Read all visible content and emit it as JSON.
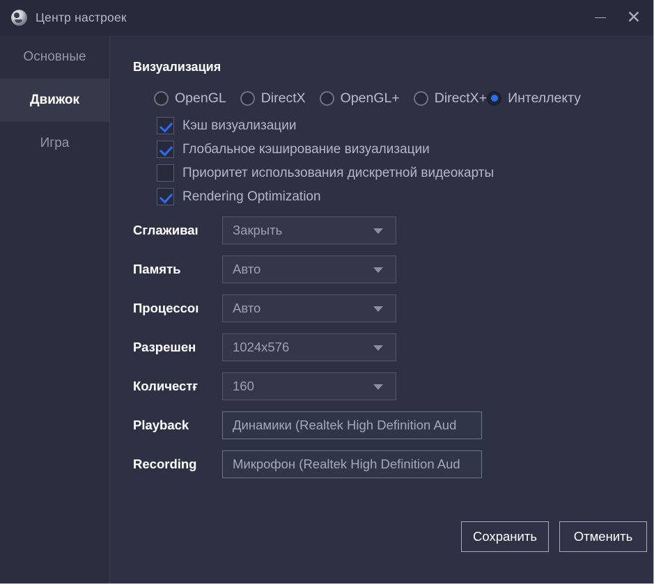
{
  "window": {
    "title": "Центр настроек",
    "icon": "steam-logo-icon",
    "minimize_label": "—",
    "close_label": "✕"
  },
  "sidebar": {
    "items": [
      {
        "label": "Основные",
        "selected": false
      },
      {
        "label": "Движок",
        "selected": true
      },
      {
        "label": "Игра",
        "selected": false
      }
    ]
  },
  "content": {
    "section_title": "Визуализация",
    "renderer": {
      "options": [
        {
          "label": "OpenGL",
          "selected": false
        },
        {
          "label": "DirectX",
          "selected": false
        },
        {
          "label": "OpenGL+",
          "selected": false
        },
        {
          "label": "DirectX+",
          "selected": false
        },
        {
          "label": "Интеллекту",
          "selected": true
        }
      ]
    },
    "checkboxes": [
      {
        "label": "Кэш визуализации",
        "checked": true
      },
      {
        "label": "Глобальное кэширование визуализации",
        "checked": true
      },
      {
        "label": "Приоритет использования дискретной видеокарты",
        "checked": false
      },
      {
        "label": "Rendering Optimization",
        "checked": true
      }
    ],
    "fields": [
      {
        "label": "Сглаживаı",
        "value": "Закрыть",
        "type": "select"
      },
      {
        "label": "Память",
        "value": "Авто",
        "type": "select"
      },
      {
        "label": "Процессоı",
        "value": "Авто",
        "type": "select"
      },
      {
        "label": "Разрешен",
        "value": "1024x576",
        "type": "select"
      },
      {
        "label": "Количестғ",
        "value": "160",
        "type": "select"
      },
      {
        "label": "Playback",
        "value": "Динамики (Realtek High Definition Aud",
        "type": "text"
      },
      {
        "label": "Recording",
        "value": "Микрофон (Realtek High Definition Aud",
        "type": "text"
      }
    ]
  },
  "footer": {
    "save_label": "Сохранить",
    "cancel_label": "Отменить"
  },
  "colors": {
    "window_bg": "#2e3144",
    "titlebar_bg": "#272a3a",
    "sidebar_bg": "#2b2e3f",
    "sidebar_selected_bg": "#353949",
    "accent_blue": "#2a6df5",
    "text_primary": "#ffffff",
    "text_muted": "#b4b7c4"
  }
}
